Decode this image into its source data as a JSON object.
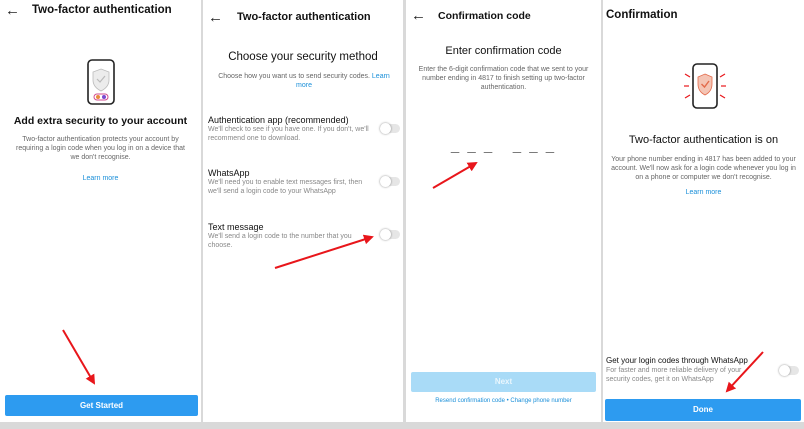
{
  "screen1": {
    "back": "←",
    "title": "Two-factor authentication",
    "heading": "Add extra security to your account",
    "body": "Two-factor authentication protects your account by requiring a login code when you log in on a device that we don't recognise.",
    "learn_more": "Learn more",
    "button": "Get Started"
  },
  "screen2": {
    "back": "←",
    "title": "Two-factor authentication",
    "heading": "Choose your security method",
    "subtitle": "Choose how you want us to send security codes.",
    "subtitle_link": "Learn more",
    "options": [
      {
        "title": "Authentication app (recommended)",
        "desc": "We'll check to see if you have one. If you don't, we'll recommend one to download.",
        "on": false
      },
      {
        "title": "WhatsApp",
        "desc": "We'll need you to enable text messages first, then we'll send a login code to your WhatsApp",
        "on": false
      },
      {
        "title": "Text message",
        "desc": "We'll send a login code to the number that you choose.",
        "on": false
      }
    ]
  },
  "screen3": {
    "back": "←",
    "title": "Confirmation code",
    "heading": "Enter confirmation code",
    "body": "Enter the 6-digit confirmation code that we sent to your number ending in 4817 to finish setting up two-factor authentication.",
    "code_display": "_ _ _   _ _ _",
    "button": "Next",
    "resend": "Resend confirmation code",
    "separator": "•",
    "change_phone": "Change phone number"
  },
  "screen4": {
    "title": "Confirmation",
    "heading": "Two-factor authentication is on",
    "body": "Your phone number ending in 4817 has been added to your account. We'll now ask for a login code whenever you log in on a phone or computer we don't recognise.",
    "learn_more": "Learn more",
    "whatsapp_title": "Get your login codes through WhatsApp",
    "whatsapp_desc": "For faster and more reliable delivery of your security codes, get it on WhatsApp",
    "whatsapp_on": false,
    "button": "Done"
  },
  "colors": {
    "accent": "#2d9bf0",
    "link": "#1a8fd9",
    "arrow": "#e8161b",
    "shield": "#f4c4b4",
    "check": "#e36a4a"
  },
  "icons": [
    "back-arrow-icon",
    "phone-shield-icon",
    "phone-shield-check-icon"
  ]
}
